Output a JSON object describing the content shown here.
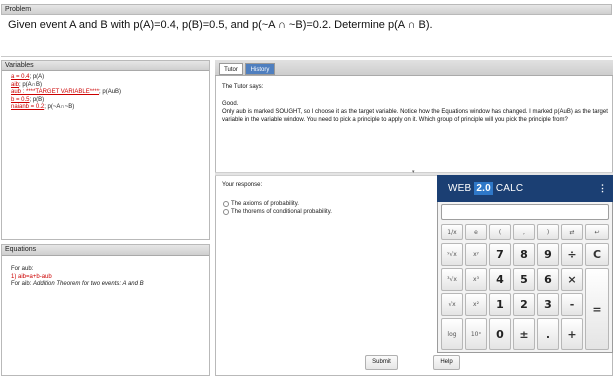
{
  "problem": {
    "header": "Problem",
    "text": "Given event A and B with p(A)=0.4, p(B)=0.5, and p(~A ∩ ~B)=0.2. Determine p(A ∩ B)."
  },
  "variables": {
    "header": "Variables",
    "items": [
      {
        "link": "a = 0.4",
        "rest": "; p(A)"
      },
      {
        "link": "aib",
        "rest": "; p(A∩B)"
      },
      {
        "link": "aub : ****TARGET VARIABLE****",
        "rest": "; p(AuB)"
      },
      {
        "link": "b = 0.5",
        "rest": "; p(B)"
      },
      {
        "link": "naianb = 0.2",
        "rest": "; p(~A∩~B)"
      }
    ]
  },
  "equations": {
    "header": "Equations",
    "for_line": "For aub:",
    "eq": "1) aib=a+b-aub",
    "note_prefix": "For aib: ",
    "note_italic": "Addition Theorem for two events: A and B"
  },
  "tabs": [
    {
      "label": "Tutor"
    },
    {
      "label": "History"
    }
  ],
  "tutor": {
    "says": "The Tutor says:",
    "good": "Good.",
    "message": "Only aub is marked SOUGHT, so I choose it as the target variable. Notice how the Equations window has changed.  I marked p(AuB) as the target variable in the variable window. You need to pick a principle to apply on it. Which group of principle will you pick the principle from?"
  },
  "response": {
    "label": "Your response:",
    "options": [
      "The axioms of probability.",
      "The thorems of conditional probability."
    ]
  },
  "buttons": {
    "submit": "Submit",
    "help": "Help"
  },
  "calculator": {
    "brand": "WEB",
    "version": "2.0",
    "name": "CALC",
    "menu": "⋮",
    "keys": {
      "r1": [
        "1/x",
        "e",
        "(",
        ",",
        ")",
        "⇄",
        "↩"
      ],
      "r2": [
        "ʸ√x",
        "xʸ",
        "7",
        "8",
        "9",
        "÷",
        "C"
      ],
      "r3": [
        "³√x",
        "x³",
        "4",
        "5",
        "6",
        "×"
      ],
      "r4": [
        "√x",
        "x²",
        "1",
        "2",
        "3",
        "-",
        "="
      ],
      "r5": [
        "log",
        "10ˣ",
        "0",
        "±",
        ".",
        "+"
      ]
    }
  },
  "colors": {
    "accent_red": "#cc0000",
    "calc_header": "#1b3f73",
    "calc_version_badge": "#2f78c8",
    "history_tab": "#4f7fbf"
  }
}
